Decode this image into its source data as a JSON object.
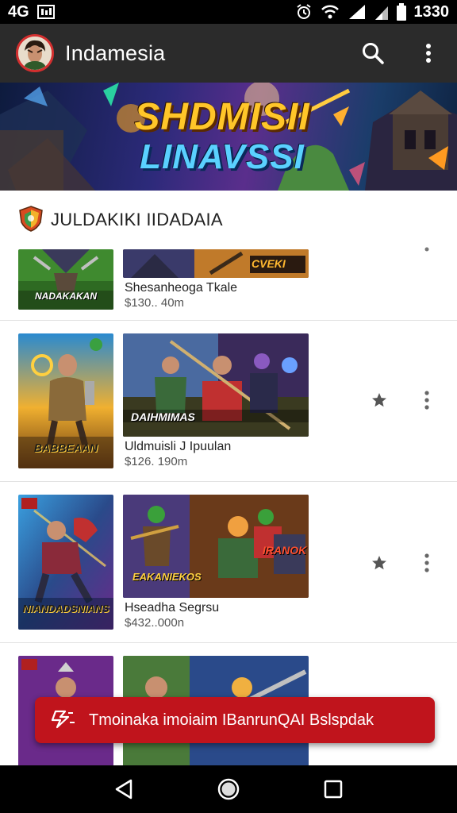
{
  "status_bar": {
    "network": "4G",
    "time": "1330",
    "icons": [
      "image-icon",
      "alarm-icon",
      "wifi-icon",
      "signal-icon",
      "battery-icon"
    ]
  },
  "app_bar": {
    "title": "Indamesia",
    "avatar_icon": "avatar",
    "actions": [
      "search-icon",
      "more-vert-icon"
    ]
  },
  "banner": {
    "line1": "SHDMISII",
    "line2": "LINAVSSI"
  },
  "section": {
    "title": "JULDAKIKI IIDADAIA",
    "icon": "game-shield-icon"
  },
  "list": [
    {
      "title": "Shesanheoga Tkale",
      "price": "$130.. 40m",
      "thumb_caption": "NADAKAKAN",
      "shot_caption": "CVEKI",
      "starred": false
    },
    {
      "title": "Uldmuisli J Ipuulan",
      "price": "$126. 190m",
      "thumb_caption": "BABBEAAN",
      "shot_caption": "DAIHMIMAS",
      "starred": true
    },
    {
      "title": "Hseadha Segrsu",
      "price": "$432..000n",
      "thumb_caption": "NIANDADSNIANS",
      "shot_caption": "EAKANIEKOS",
      "shot_caption2": "IRANOK",
      "starred": true
    },
    {
      "title": "",
      "price": "",
      "starred": false
    }
  ],
  "snackbar": {
    "text": "Tmoinaka imoiaim IBanrunQAI Bslspdak",
    "icon": "flash-icon"
  },
  "nav_bar": {
    "buttons": [
      "back-icon",
      "home-icon",
      "recents-icon"
    ]
  },
  "colors": {
    "app_bar": "#2b2b2b",
    "accent": "#c0141c",
    "star": "#555555"
  }
}
